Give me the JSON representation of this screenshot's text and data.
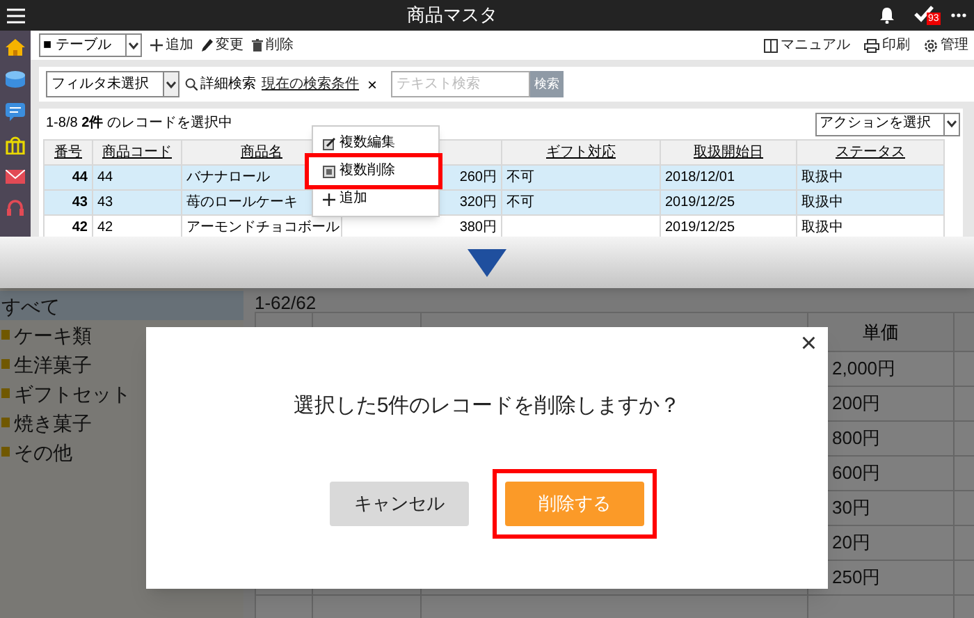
{
  "top_screen": {
    "header": {
      "title": "商品マスタ",
      "badge": "93"
    },
    "toolbar": {
      "view_select": "■ テーブル",
      "actions": [
        {
          "label": "追加",
          "kind": "add"
        },
        {
          "label": "変更",
          "kind": "edit"
        },
        {
          "label": "削除",
          "kind": "delete"
        }
      ],
      "links": [
        {
          "label": "マニュアル",
          "kind": "manual"
        },
        {
          "label": "印刷",
          "kind": "print"
        },
        {
          "label": "管理",
          "kind": "settings"
        }
      ]
    },
    "filter": {
      "select": "フィルタ未選択",
      "detail_search": "詳細検索",
      "current_conditions": "現在の検索条件",
      "clear": "×",
      "search_placeholder": "テキスト検索",
      "search_button": "検索"
    },
    "summary": "1-8/8 **2件** のレコードを選択中",
    "action_select": "アクションを選択",
    "table": {
      "columns": [
        {
          "label": "番号"
        },
        {
          "label": "商品コード"
        },
        {
          "label": "商品名"
        },
        {},
        {
          "label": "ギフト対応"
        },
        {
          "label": "取扱開始日"
        },
        {
          "label": "ステータス"
        }
      ],
      "rows": [
        {
          "selected": true,
          "cells": [
            "44",
            "44",
            "バナナロール",
            "260円",
            "不可",
            "2018/12/01",
            "取扱中"
          ]
        },
        {
          "selected": true,
          "cells": [
            "43",
            "43",
            "苺のロールケーキ",
            "320円",
            "不可",
            "2019/12/25",
            "取扱中"
          ]
        },
        {
          "selected": false,
          "cells": [
            "42",
            "42",
            "アーモンドチョコボール",
            "380円",
            null,
            "2019/12/25",
            "取扱中"
          ]
        }
      ]
    },
    "context_menu": {
      "items": [
        {
          "label": "複数編集",
          "kind": "edit",
          "highlighted": false
        },
        {
          "label": "複数削除",
          "kind": "delete",
          "highlighted": true
        },
        {
          "label": "追加",
          "kind": "add",
          "highlighted": false
        }
      ]
    }
  },
  "bottom_screen": {
    "categories": [
      {
        "label": "すべて",
        "selected": true
      },
      {
        "label": "ケーキ類",
        "selected": false
      },
      {
        "label": "生洋菓子",
        "selected": false
      },
      {
        "label": "ギフトセット",
        "selected": false
      },
      {
        "label": "焼き菓子",
        "selected": false
      },
      {
        "label": "その他",
        "selected": false
      }
    ],
    "count": "1-62/62",
    "price_header": "単価",
    "price_cells": [
      "2,000円",
      "200円",
      "800円",
      "600円",
      "30円",
      "20円",
      "250円"
    ],
    "dialog": {
      "message": "選択した5件のレコードを削除しますか？",
      "close": "×",
      "buttons": [
        {
          "label": "キャンセル",
          "kind": "cancel",
          "highlighted": false
        },
        {
          "label": "削除する",
          "kind": "primary",
          "highlighted": true
        }
      ]
    }
  }
}
